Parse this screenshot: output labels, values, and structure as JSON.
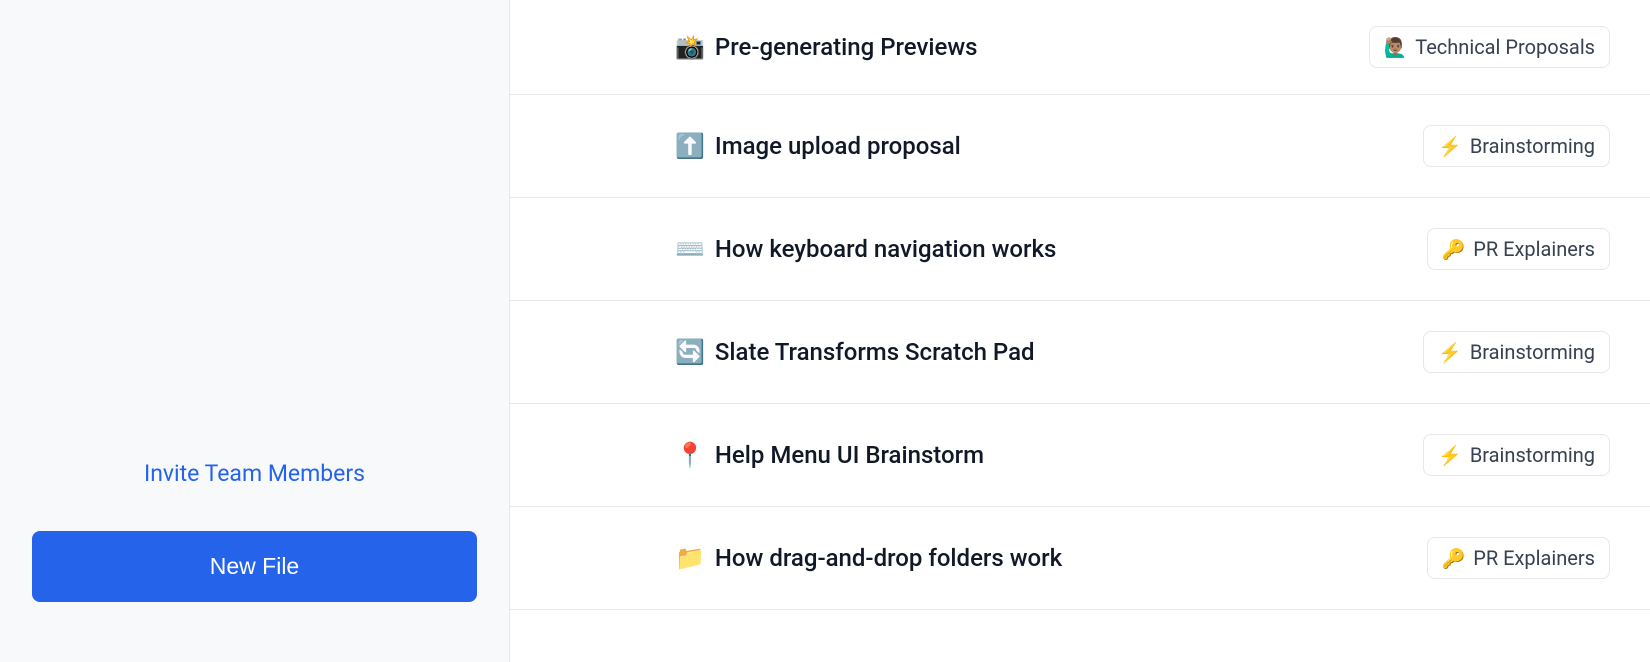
{
  "sidebar": {
    "invite_label": "Invite Team Members",
    "new_file_label": "New File"
  },
  "files": [
    {
      "emoji": "📸",
      "title": "Pre-generating Previews",
      "category_emoji": "🙋🏽‍♂️",
      "category_label": "Technical Proposals"
    },
    {
      "emoji": "⬆️",
      "title": "Image upload proposal",
      "category_emoji": "⚡",
      "category_label": "Brainstorming"
    },
    {
      "emoji": "⌨️",
      "title": "How keyboard navigation works",
      "category_emoji": "🔑",
      "category_label": "PR Explainers"
    },
    {
      "emoji": "🔄",
      "title": "Slate Transforms Scratch Pad",
      "category_emoji": "⚡",
      "category_label": "Brainstorming"
    },
    {
      "emoji": "📍",
      "title": "Help Menu UI Brainstorm",
      "category_emoji": "⚡",
      "category_label": "Brainstorming"
    },
    {
      "emoji": "📁",
      "title": "How drag-and-drop folders work",
      "category_emoji": "🔑",
      "category_label": "PR Explainers"
    }
  ]
}
